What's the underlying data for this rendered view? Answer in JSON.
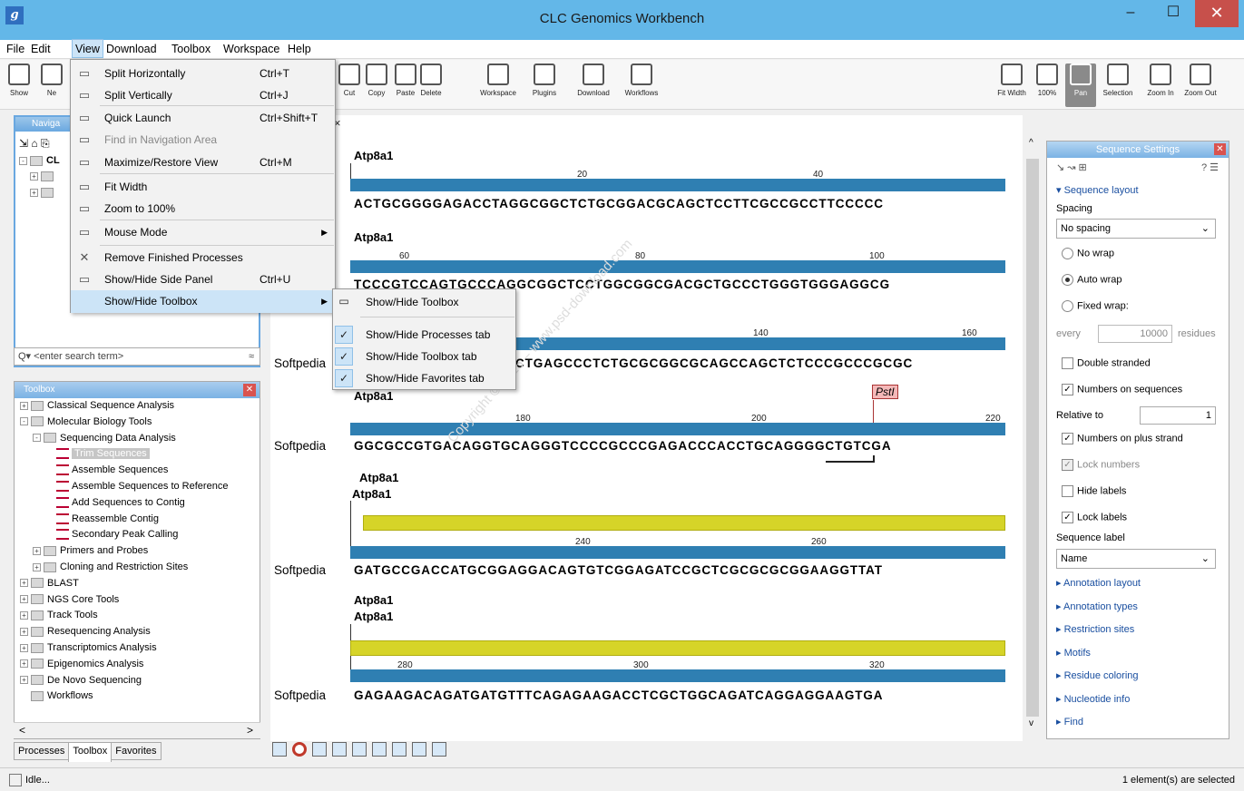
{
  "window": {
    "title": "CLC Genomics Workbench",
    "minimize": "–",
    "maximize": "☐",
    "close": "✕"
  },
  "menubar": [
    "File",
    "Edit",
    "View",
    "Download",
    "Toolbox",
    "Workspace",
    "Help"
  ],
  "toolbar": {
    "left": [
      "Show",
      "Ne"
    ],
    "main": [
      "Cut",
      "Copy",
      "Paste",
      "Delete",
      "Workspace",
      "Plugins",
      "Download",
      "Workflows"
    ],
    "right": [
      "Fit Width",
      "100%",
      "Pan",
      "Selection",
      "Zoom In",
      "Zoom Out"
    ]
  },
  "view_menu": [
    {
      "label": "Split Horizontally",
      "shortcut": "Ctrl+T",
      "icon": "split-horizontal-icon"
    },
    {
      "label": "Split Vertically",
      "shortcut": "Ctrl+J",
      "icon": "split-vertical-icon"
    },
    {
      "label": "Quick Launch",
      "shortcut": "Ctrl+Shift+T",
      "icon": "quick-launch-icon"
    },
    {
      "label": "Find in Navigation Area",
      "shortcut": "",
      "icon": "find-icon",
      "disabled": true
    },
    {
      "label": "Maximize/Restore View",
      "shortcut": "Ctrl+M",
      "icon": "maximize-icon"
    },
    {
      "label": "Fit Width",
      "shortcut": "",
      "icon": "fit-width-icon"
    },
    {
      "label": "Zoom to 100%",
      "shortcut": "",
      "icon": "zoom-100-icon"
    },
    {
      "label": "Mouse Mode",
      "shortcut": "",
      "icon": "mouse-icon",
      "submenu": true
    },
    {
      "label": "Remove Finished Processes",
      "shortcut": "",
      "icon": "remove-icon"
    },
    {
      "label": "Show/Hide Side Panel",
      "shortcut": "Ctrl+U",
      "icon": "side-panel-icon"
    },
    {
      "label": "Show/Hide Toolbox",
      "shortcut": "",
      "icon": "",
      "submenu": true
    }
  ],
  "submenu": [
    {
      "label": "Show/Hide Toolbox",
      "checked": false
    },
    {
      "label": "Show/Hide Processes tab",
      "checked": true
    },
    {
      "label": "Show/Hide Toolbox tab",
      "checked": true
    },
    {
      "label": "Show/Hide Favorites tab",
      "checked": true
    }
  ],
  "navigation": {
    "title": "Naviga",
    "root_label": "CL",
    "search_placeholder": "<enter search term>"
  },
  "toolbox": {
    "title": "Toolbox",
    "items": [
      {
        "label": "Classical Sequence Analysis",
        "level": 0,
        "toggle": "+"
      },
      {
        "label": "Molecular Biology Tools",
        "level": 0,
        "toggle": "-"
      },
      {
        "label": "Sequencing Data Analysis",
        "level": 1,
        "toggle": "-"
      },
      {
        "label": "Trim Sequences",
        "level": 2,
        "selected": true
      },
      {
        "label": "Assemble Sequences",
        "level": 2
      },
      {
        "label": "Assemble Sequences to Reference",
        "level": 2
      },
      {
        "label": "Add Sequences to Contig",
        "level": 2
      },
      {
        "label": "Reassemble Contig",
        "level": 2
      },
      {
        "label": "Secondary Peak Calling",
        "level": 2
      },
      {
        "label": "Primers and Probes",
        "level": 1,
        "toggle": "+"
      },
      {
        "label": "Cloning and Restriction Sites",
        "level": 1,
        "toggle": "+"
      },
      {
        "label": "BLAST",
        "level": 0,
        "toggle": "+"
      },
      {
        "label": "NGS Core Tools",
        "level": 0,
        "toggle": "+"
      },
      {
        "label": "Track Tools",
        "level": 0,
        "toggle": "+"
      },
      {
        "label": "Resequencing Analysis",
        "level": 0,
        "toggle": "+"
      },
      {
        "label": "Transcriptomics Analysis",
        "level": 0,
        "toggle": "+"
      },
      {
        "label": "Epigenomics Analysis",
        "level": 0,
        "toggle": "+"
      },
      {
        "label": "De Novo Sequencing",
        "level": 0,
        "toggle": "+"
      },
      {
        "label": "Workflows",
        "level": 0,
        "toggle": ""
      }
    ],
    "tabs": [
      "Processes",
      "Toolbox",
      "Favorites"
    ]
  },
  "editor": {
    "tab_close": "×",
    "label": "Atp8a1",
    "side_label": "Softpedia",
    "enzyme": "PstI",
    "watermark": "Copyright © 2015 – www.psd-download.com",
    "rows": [
      {
        "numbers": [
          "20",
          "40"
        ],
        "seq": "ACTGCGGGGAGACCTAGGCGGCTCTGCGGACGCAGCTCCTTCGCCGCCTTCCCCC"
      },
      {
        "numbers": [
          "60",
          "80",
          "100"
        ],
        "seq": "TCCCGTCCAGTGCCCAGGCGGCTCCTGGCGGCGACGCTGCCCTGGGTGGGAGGCG"
      },
      {
        "numbers": [
          "140",
          "160"
        ],
        "seq": "CTGAGCCCTCTGCGCGGCGCAGCCAGCTCTCCCGCCCGCGC"
      },
      {
        "numbers": [
          "180",
          "200",
          "220"
        ],
        "seq": "GGCGCCGTGACAGGTGCAGGGTCCCCGCCCGAGACCCACCTGCAGGGGCTGTCGA"
      },
      {
        "numbers": [
          "240",
          "260"
        ],
        "seq": "GATGCCGACCATGCGGAGGACAGTGTCGGAGATCCGCTCGCGCGCGGAAGGTTAT"
      },
      {
        "numbers": [
          "280",
          "300",
          "320"
        ],
        "seq": "GAGAAGACAGATGATGTTTCAGAGAAGACCTCGCTGGCAGATCAGGAGGAAGTGA"
      }
    ]
  },
  "settings": {
    "title": "Sequence Settings",
    "section": "Sequence layout",
    "spacing_label": "Spacing",
    "spacing_value": "No spacing",
    "no_wrap": "No wrap",
    "auto_wrap": "Auto wrap",
    "fixed_wrap": "Fixed wrap:",
    "every": "every",
    "every_value": "10000",
    "residues": "residues",
    "double_stranded": "Double stranded",
    "numbers_on_sequences": "Numbers on sequences",
    "relative_to": "Relative to",
    "relative_value": "1",
    "numbers_plus": "Numbers on plus strand",
    "lock_numbers": "Lock numbers",
    "hide_labels": "Hide labels",
    "lock_labels": "Lock labels",
    "sequence_label": "Sequence label",
    "sequence_label_value": "Name",
    "collapsed": [
      "Annotation layout",
      "Annotation types",
      "Restriction sites",
      "Motifs",
      "Residue coloring",
      "Nucleotide info",
      "Find"
    ]
  },
  "status": {
    "left": "Idle...",
    "right": "1 element(s) are selected"
  }
}
